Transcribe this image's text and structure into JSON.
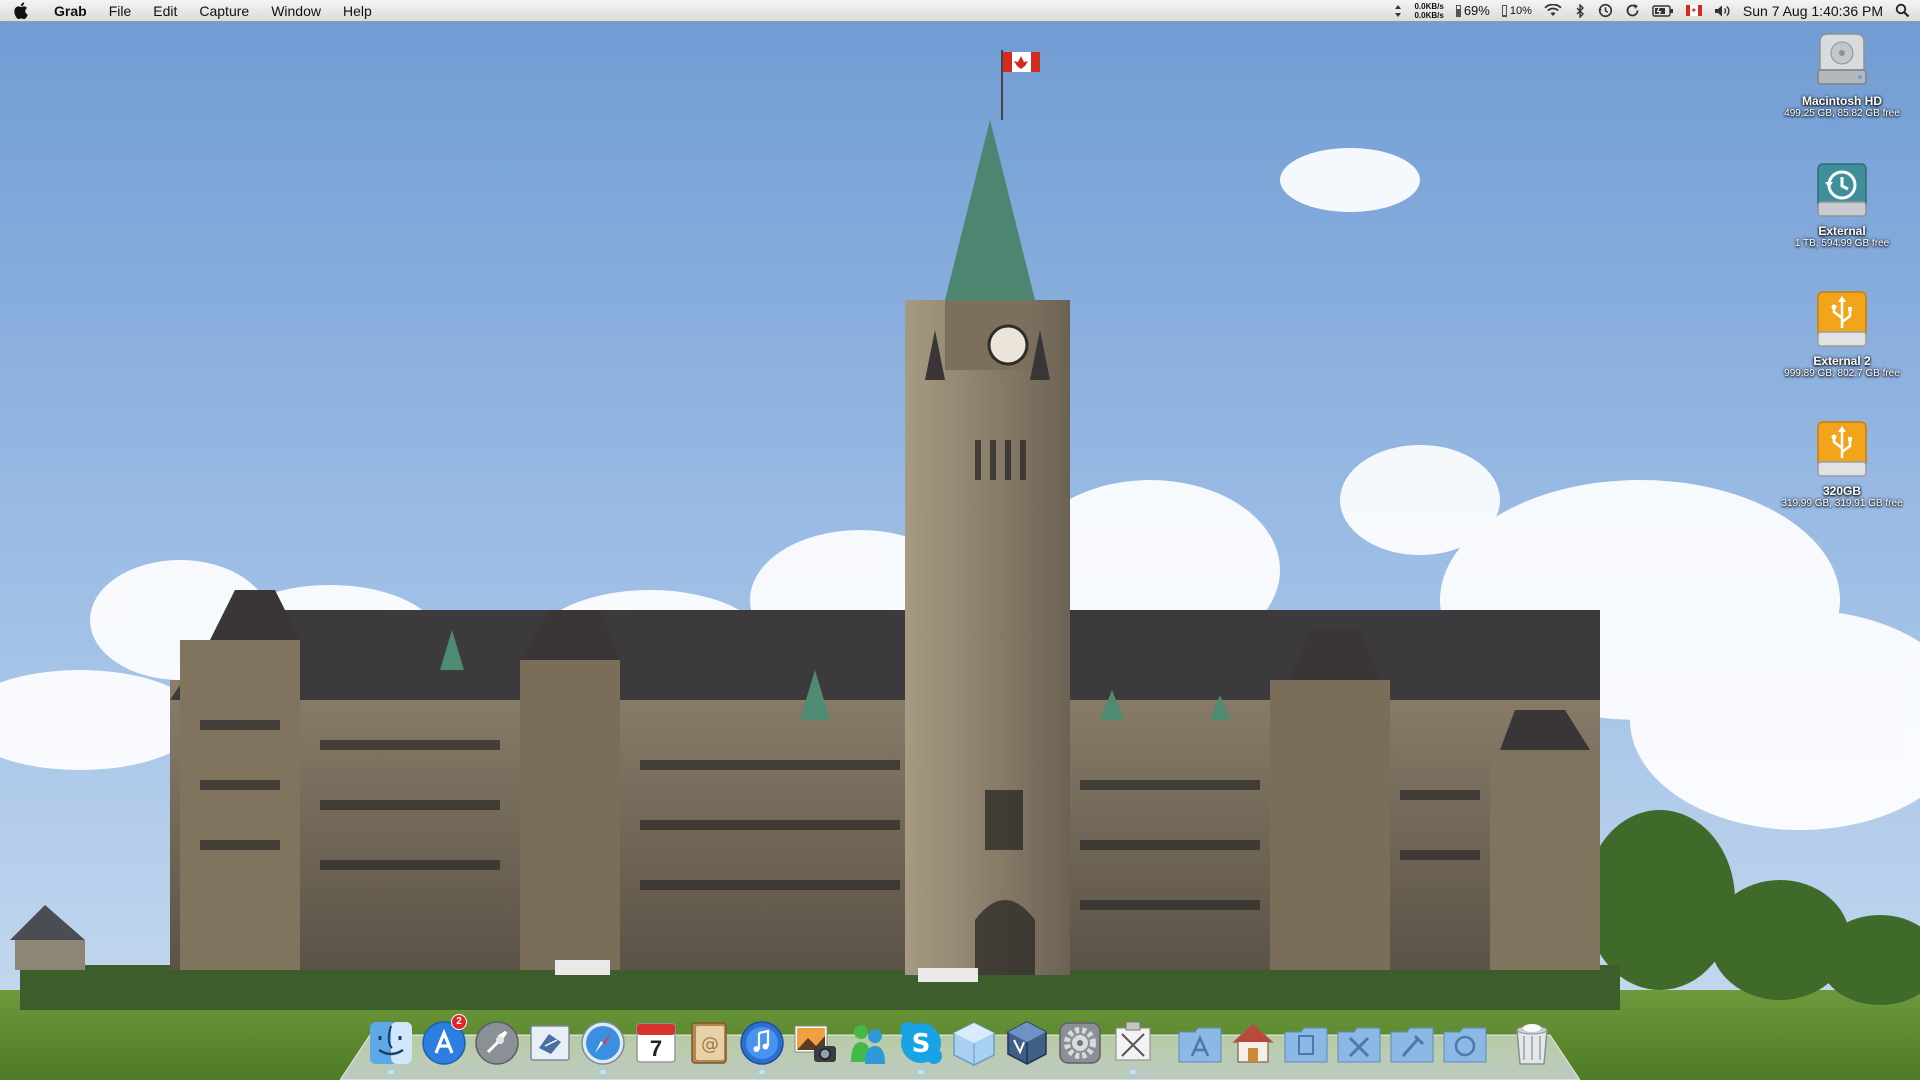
{
  "menubar": {
    "app_name": "Grab",
    "menus": [
      "File",
      "Edit",
      "Capture",
      "Window",
      "Help"
    ],
    "status": {
      "net_up": "0.0KB/s",
      "net_down": "0.0KB/s",
      "battery_percent": "69%",
      "cpu_percent": "10%",
      "datetime": "Sun 7 Aug  1:40:36 PM"
    },
    "status_icons": [
      "sync-arrows-icon",
      "wifi-icon",
      "bluetooth-icon",
      "time-machine-icon",
      "sync-icon",
      "battery-icon",
      "canada-flag-icon",
      "volume-icon",
      "spotlight-search-icon"
    ]
  },
  "desktop_icons": [
    {
      "name": "Macintosh HD",
      "info": "499.25 GB, 85.82 GB free",
      "icon": "hard-drive-icon"
    },
    {
      "name": "External",
      "info": "1 TB, 594.99 GB free",
      "icon": "time-machine-drive-icon"
    },
    {
      "name": "External 2",
      "info": "999.89 GB, 802.7 GB free",
      "icon": "usb-drive-icon"
    },
    {
      "name": "320GB",
      "info": "319.99 GB, 319.91 GB free",
      "icon": "usb-drive-icon"
    }
  ],
  "dock": {
    "calendar_day": "7",
    "app_store_badge": "2",
    "items": [
      "finder-icon",
      "app-store-icon",
      "launchpad-icon",
      "mail-icon",
      "safari-icon",
      "ical-icon",
      "address-book-icon",
      "itunes-icon",
      "iphoto-icon",
      "messenger-icon",
      "skype-icon",
      "box-app-icon",
      "virtualbox-icon",
      "system-preferences-icon",
      "grab-icon",
      "applications-stack-icon",
      "home-folder-icon",
      "documents-stack-icon",
      "utilities-stack-icon",
      "developer-stack-icon",
      "downloads-stack-icon",
      "trash-icon"
    ]
  },
  "colors": {
    "sky": "#7da7d8",
    "menubar": "#e6e6e6",
    "usb_orange": "#f2a51a"
  }
}
